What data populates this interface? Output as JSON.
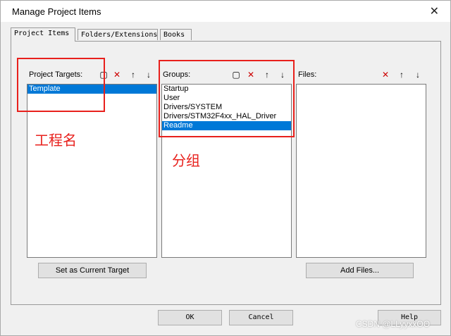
{
  "window": {
    "title": "Manage Project Items"
  },
  "tabs": [
    {
      "label": "Project Items",
      "active": true
    },
    {
      "label": "Folders/Extensions",
      "active": false
    },
    {
      "label": "Books",
      "active": false
    }
  ],
  "targets": {
    "label": "Project Targets:",
    "items": [
      "Template"
    ],
    "selected": 0,
    "button": "Set as Current Target"
  },
  "groups": {
    "label": "Groups:",
    "items": [
      "Startup",
      "User",
      "Drivers/SYSTEM",
      "Drivers/STM32F4xx_HAL_Driver",
      "Readme"
    ],
    "selected": 4
  },
  "files": {
    "label": "Files:",
    "items": [],
    "button": "Add Files..."
  },
  "footer": {
    "ok": "OK",
    "cancel": "Cancel",
    "help": "Help"
  },
  "annotations": {
    "target_note": "工程名",
    "group_note": "分组"
  },
  "watermark": "CSDN @LLyyxxOO",
  "colors": {
    "selection": "#0078d7",
    "annotation": "#e8201c"
  }
}
